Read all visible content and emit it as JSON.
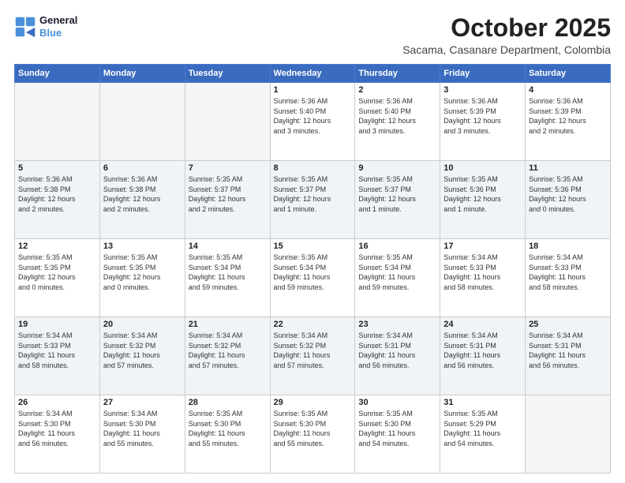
{
  "logo": {
    "line1": "General",
    "line2": "Blue"
  },
  "title": "October 2025",
  "subtitle": "Sacama, Casanare Department, Colombia",
  "days_of_week": [
    "Sunday",
    "Monday",
    "Tuesday",
    "Wednesday",
    "Thursday",
    "Friday",
    "Saturday"
  ],
  "weeks": [
    [
      {
        "day": "",
        "info": ""
      },
      {
        "day": "",
        "info": ""
      },
      {
        "day": "",
        "info": ""
      },
      {
        "day": "1",
        "info": "Sunrise: 5:36 AM\nSunset: 5:40 PM\nDaylight: 12 hours\nand 3 minutes."
      },
      {
        "day": "2",
        "info": "Sunrise: 5:36 AM\nSunset: 5:40 PM\nDaylight: 12 hours\nand 3 minutes."
      },
      {
        "day": "3",
        "info": "Sunrise: 5:36 AM\nSunset: 5:39 PM\nDaylight: 12 hours\nand 3 minutes."
      },
      {
        "day": "4",
        "info": "Sunrise: 5:36 AM\nSunset: 5:39 PM\nDaylight: 12 hours\nand 2 minutes."
      }
    ],
    [
      {
        "day": "5",
        "info": "Sunrise: 5:36 AM\nSunset: 5:38 PM\nDaylight: 12 hours\nand 2 minutes."
      },
      {
        "day": "6",
        "info": "Sunrise: 5:36 AM\nSunset: 5:38 PM\nDaylight: 12 hours\nand 2 minutes."
      },
      {
        "day": "7",
        "info": "Sunrise: 5:35 AM\nSunset: 5:37 PM\nDaylight: 12 hours\nand 2 minutes."
      },
      {
        "day": "8",
        "info": "Sunrise: 5:35 AM\nSunset: 5:37 PM\nDaylight: 12 hours\nand 1 minute."
      },
      {
        "day": "9",
        "info": "Sunrise: 5:35 AM\nSunset: 5:37 PM\nDaylight: 12 hours\nand 1 minute."
      },
      {
        "day": "10",
        "info": "Sunrise: 5:35 AM\nSunset: 5:36 PM\nDaylight: 12 hours\nand 1 minute."
      },
      {
        "day": "11",
        "info": "Sunrise: 5:35 AM\nSunset: 5:36 PM\nDaylight: 12 hours\nand 0 minutes."
      }
    ],
    [
      {
        "day": "12",
        "info": "Sunrise: 5:35 AM\nSunset: 5:35 PM\nDaylight: 12 hours\nand 0 minutes."
      },
      {
        "day": "13",
        "info": "Sunrise: 5:35 AM\nSunset: 5:35 PM\nDaylight: 12 hours\nand 0 minutes."
      },
      {
        "day": "14",
        "info": "Sunrise: 5:35 AM\nSunset: 5:34 PM\nDaylight: 11 hours\nand 59 minutes."
      },
      {
        "day": "15",
        "info": "Sunrise: 5:35 AM\nSunset: 5:34 PM\nDaylight: 11 hours\nand 59 minutes."
      },
      {
        "day": "16",
        "info": "Sunrise: 5:35 AM\nSunset: 5:34 PM\nDaylight: 11 hours\nand 59 minutes."
      },
      {
        "day": "17",
        "info": "Sunrise: 5:34 AM\nSunset: 5:33 PM\nDaylight: 11 hours\nand 58 minutes."
      },
      {
        "day": "18",
        "info": "Sunrise: 5:34 AM\nSunset: 5:33 PM\nDaylight: 11 hours\nand 58 minutes."
      }
    ],
    [
      {
        "day": "19",
        "info": "Sunrise: 5:34 AM\nSunset: 5:33 PM\nDaylight: 11 hours\nand 58 minutes."
      },
      {
        "day": "20",
        "info": "Sunrise: 5:34 AM\nSunset: 5:32 PM\nDaylight: 11 hours\nand 57 minutes."
      },
      {
        "day": "21",
        "info": "Sunrise: 5:34 AM\nSunset: 5:32 PM\nDaylight: 11 hours\nand 57 minutes."
      },
      {
        "day": "22",
        "info": "Sunrise: 5:34 AM\nSunset: 5:32 PM\nDaylight: 11 hours\nand 57 minutes."
      },
      {
        "day": "23",
        "info": "Sunrise: 5:34 AM\nSunset: 5:31 PM\nDaylight: 11 hours\nand 56 minutes."
      },
      {
        "day": "24",
        "info": "Sunrise: 5:34 AM\nSunset: 5:31 PM\nDaylight: 11 hours\nand 56 minutes."
      },
      {
        "day": "25",
        "info": "Sunrise: 5:34 AM\nSunset: 5:31 PM\nDaylight: 11 hours\nand 56 minutes."
      }
    ],
    [
      {
        "day": "26",
        "info": "Sunrise: 5:34 AM\nSunset: 5:30 PM\nDaylight: 11 hours\nand 56 minutes."
      },
      {
        "day": "27",
        "info": "Sunrise: 5:34 AM\nSunset: 5:30 PM\nDaylight: 11 hours\nand 55 minutes."
      },
      {
        "day": "28",
        "info": "Sunrise: 5:35 AM\nSunset: 5:30 PM\nDaylight: 11 hours\nand 55 minutes."
      },
      {
        "day": "29",
        "info": "Sunrise: 5:35 AM\nSunset: 5:30 PM\nDaylight: 11 hours\nand 55 minutes."
      },
      {
        "day": "30",
        "info": "Sunrise: 5:35 AM\nSunset: 5:30 PM\nDaylight: 11 hours\nand 54 minutes."
      },
      {
        "day": "31",
        "info": "Sunrise: 5:35 AM\nSunset: 5:29 PM\nDaylight: 11 hours\nand 54 minutes."
      },
      {
        "day": "",
        "info": ""
      }
    ]
  ]
}
